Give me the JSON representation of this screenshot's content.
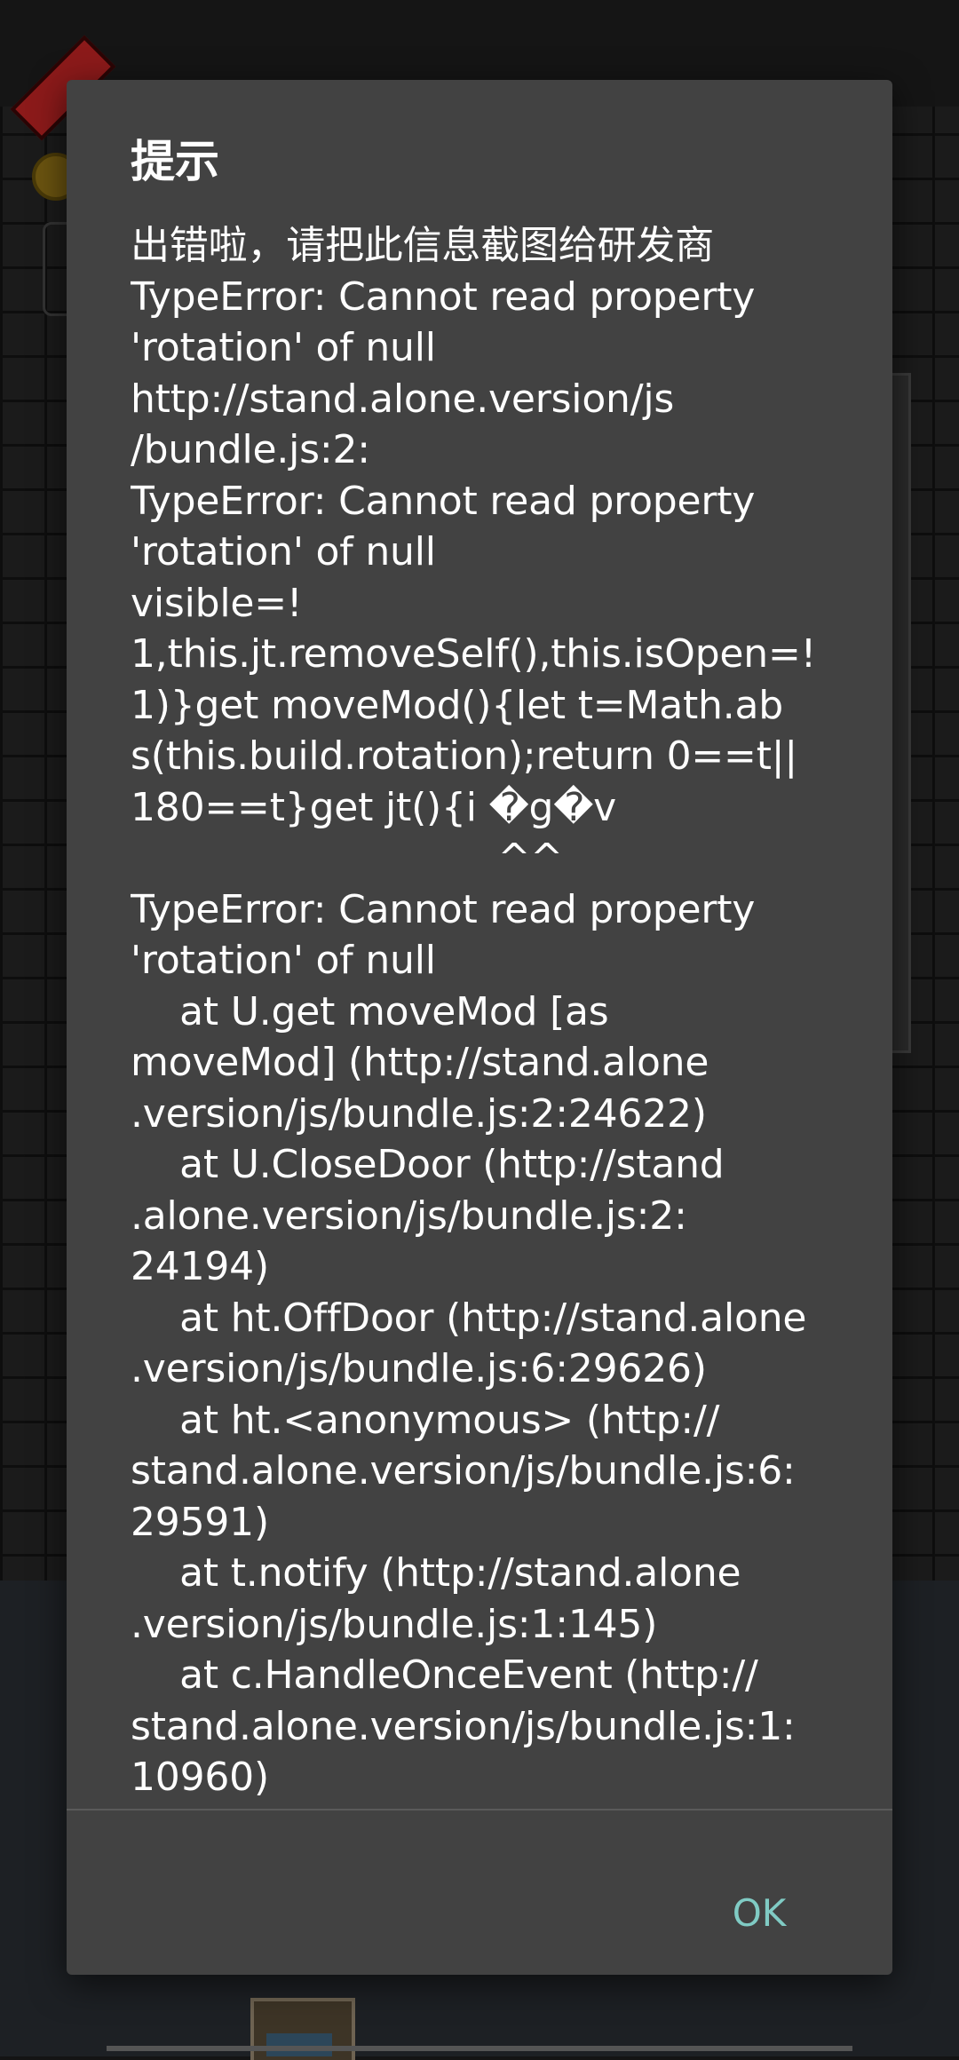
{
  "dialog": {
    "title": "提示",
    "message_lines": [
      "出错啦，请把此信息截图给研发商",
      "TypeError: Cannot read property",
      "'rotation' of null",
      "http://stand.alone.version/js",
      "/bundle.js:2:",
      "TypeError: Cannot read property",
      "'rotation' of null",
      "visible=!",
      "1,this.jt.removeSelf(),this.isOpen=!",
      "1)}get moveMod(){let t=Math.ab",
      "s(this.build.rotation);return 0==t||",
      "180==t}get jt(){i �g�v",
      "                              ^^",
      "TypeError: Cannot read property",
      "'rotation' of null",
      "    at U.get moveMod [as",
      "moveMod] (http://stand.alone",
      ".version/js/bundle.js:2:24622)",
      "    at U.CloseDoor (http://stand",
      ".alone.version/js/bundle.js:2:",
      "24194)",
      "    at ht.OffDoor (http://stand.alone",
      ".version/js/bundle.js:6:29626)",
      "    at ht.<anonymous> (http://",
      "stand.alone.version/js/bundle.js:6:",
      "29591)",
      "    at t.notify (http://stand.alone",
      ".version/js/bundle.js:1:145)",
      "    at c.HandleOnceEvent (http://",
      "stand.alone.version/js/bundle.js:1:",
      "10960)"
    ],
    "ok_label": "OK",
    "ok_color": "#80cbc4",
    "background_color": "#424242"
  }
}
